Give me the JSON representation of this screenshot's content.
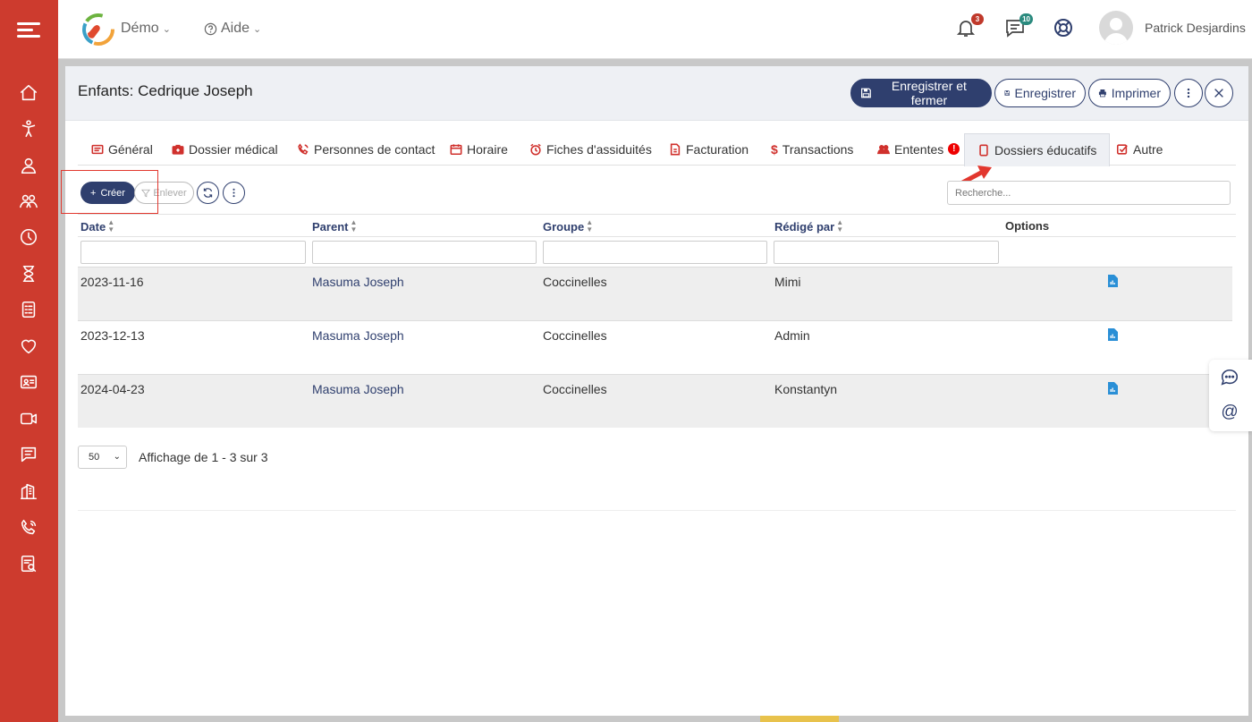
{
  "colors": {
    "sidebar": "#cd3b2e",
    "primary": "#2f3f6e",
    "accent_red": "#d0312d",
    "annotation_red": "#e2372e"
  },
  "topbar": {
    "workspace": "Démo",
    "help": "Aide",
    "notifications_count": "3",
    "messages_count": "10",
    "user_name": "Patrick Desjardins",
    "icons": [
      "bell-icon",
      "chat-icon",
      "lifebuoy-icon"
    ]
  },
  "sidebar": {
    "items": [
      "home-icon",
      "child-icon",
      "user-icon",
      "group-icon",
      "clock-icon",
      "hourglass-icon",
      "document-list-icon",
      "heart-icon",
      "id-card-icon",
      "video-icon",
      "message-icon",
      "building-icon",
      "phone-icon",
      "report-icon"
    ]
  },
  "header": {
    "title": "Enfants: Cedrique Joseph",
    "save_close": "Enregistrer et fermer",
    "save": "Enregistrer",
    "print": "Imprimer"
  },
  "tabs": [
    {
      "label": "Général",
      "icon": "list-icon"
    },
    {
      "label": "Dossier médical",
      "icon": "medkit-icon"
    },
    {
      "label": "Personnes de contact",
      "icon": "phone-ring-icon"
    },
    {
      "label": "Horaire",
      "icon": "calendar-icon"
    },
    {
      "label": "Fiches d'assiduités",
      "icon": "alarm-icon"
    },
    {
      "label": "Facturation",
      "icon": "invoice-icon"
    },
    {
      "label": "Transactions",
      "icon": "dollar-icon"
    },
    {
      "label": "Ententes",
      "icon": "users-icon",
      "alert": "!"
    },
    {
      "label": "Dossiers éducatifs",
      "icon": "file-icon",
      "active": true
    },
    {
      "label": "Autre",
      "icon": "check-square-icon"
    }
  ],
  "toolbar": {
    "create": "Créer",
    "remove_filter": "Enlever",
    "search_placeholder": "Recherche..."
  },
  "table": {
    "columns": [
      "Date",
      "Parent",
      "Groupe",
      "Rédigé par",
      "Options"
    ],
    "rows": [
      {
        "date": "2023-11-16",
        "parent": "Masuma Joseph",
        "group": "Coccinelles",
        "author": "Mimi"
      },
      {
        "date": "2023-12-13",
        "parent": "Masuma Joseph",
        "group": "Coccinelles",
        "author": "Admin"
      },
      {
        "date": "2024-04-23",
        "parent": "Masuma Joseph",
        "group": "Coccinelles",
        "author": "Konstantyn"
      }
    ]
  },
  "footer": {
    "page_size": "50",
    "page_info": "Affichage de 1 - 3 sur 3"
  },
  "side_widget": {
    "mention": "@"
  }
}
